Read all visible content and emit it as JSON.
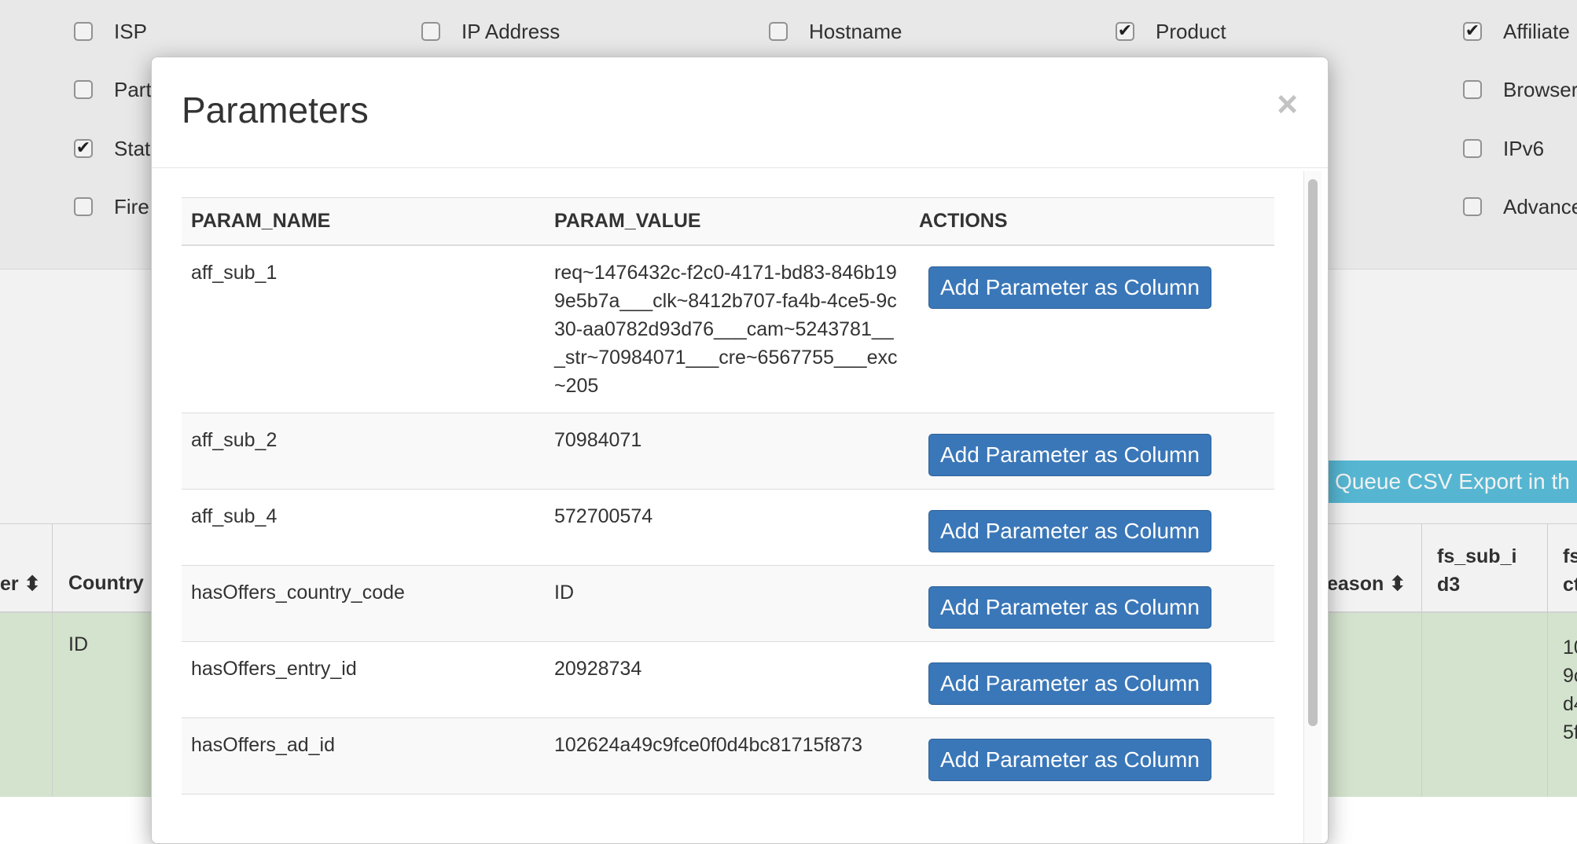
{
  "filters": [
    {
      "label": "ISP",
      "checked": false
    },
    {
      "label": "IP Address",
      "checked": false
    },
    {
      "label": "Hostname",
      "checked": false
    },
    {
      "label": "Product",
      "checked": true
    },
    {
      "label": "Affiliate",
      "checked": true
    },
    {
      "label": "Part",
      "checked": false
    },
    {
      "label": "Browser",
      "checked": false
    },
    {
      "label": "Stat",
      "checked": true
    },
    {
      "label": "IPv6",
      "checked": false
    },
    {
      "label": "Fire",
      "checked": false
    },
    {
      "label": "Advance",
      "checked": false
    }
  ],
  "export_button": "Queue CSV Export in th",
  "background_table": {
    "headers": [
      "er",
      "Country",
      "eason",
      "fs_sub_i d3",
      "fs ct"
    ],
    "row": {
      "country": "ID",
      "partial_lines": [
        "10",
        "9c",
        "d4",
        "5f"
      ]
    }
  },
  "modal": {
    "title": "Parameters",
    "close_symbol": "×",
    "columns": [
      "PARAM_NAME",
      "PARAM_VALUE",
      "ACTIONS"
    ],
    "rows": [
      {
        "name": "aff_sub_1",
        "value": "req~1476432c-f2c0-4171-bd83-846b199e5b7a___clk~8412b707-fa4b-4ce5-9c30-aa0782d93d76___cam~5243781___str~70984071___cre~6567755___exc~205",
        "action": "Add Parameter as Column"
      },
      {
        "name": "aff_sub_2",
        "value": "70984071",
        "action": "Add Parameter as Column"
      },
      {
        "name": "aff_sub_4",
        "value": "572700574",
        "action": "Add Parameter as Column"
      },
      {
        "name": "hasOffers_country_code",
        "value": "ID",
        "action": "Add Parameter as Column"
      },
      {
        "name": "hasOffers_entry_id",
        "value": "20928734",
        "action": "Add Parameter as Column"
      },
      {
        "name": "hasOffers_ad_id",
        "value": "102624a49c9fce0f0d4bc81715f873",
        "action": "Add Parameter as Column"
      }
    ]
  }
}
